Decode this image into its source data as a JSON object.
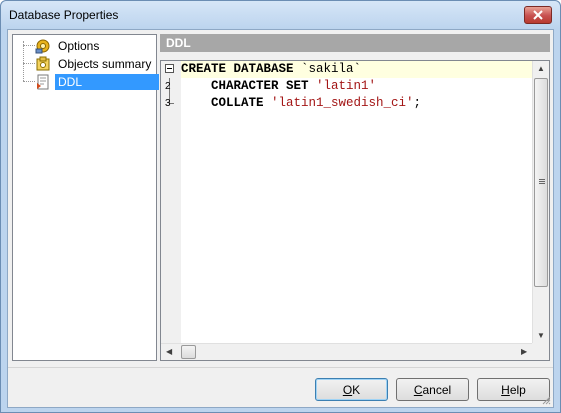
{
  "window": {
    "title": "Database Properties"
  },
  "tree": {
    "items": [
      {
        "label": "Options",
        "icon": "options-icon",
        "selected": false
      },
      {
        "label": "Objects summary",
        "icon": "objects-summary-icon",
        "selected": false
      },
      {
        "label": "DDL",
        "icon": "ddl-icon",
        "selected": true
      }
    ]
  },
  "panel": {
    "header": "DDL"
  },
  "editor": {
    "lines": [
      {
        "number": "",
        "parts": [
          {
            "text": "CREATE DATABASE ",
            "cls": "kw"
          },
          {
            "text": "`sakila`",
            "cls": "ident"
          }
        ]
      },
      {
        "number": "2",
        "parts": [
          {
            "text": "    CHARACTER SET ",
            "cls": "kw"
          },
          {
            "text": "'latin1'",
            "cls": "str"
          }
        ]
      },
      {
        "number": "3",
        "parts": [
          {
            "text": "    COLLATE ",
            "cls": "kw"
          },
          {
            "text": "'latin1_swedish_ci'",
            "cls": "str"
          },
          {
            "text": ";",
            "cls": "ident"
          }
        ]
      }
    ]
  },
  "buttons": {
    "ok": {
      "accel": "O",
      "rest": "K"
    },
    "cancel": {
      "accel": "C",
      "rest": "ancel"
    },
    "help": {
      "accel": "H",
      "rest": "elp"
    }
  },
  "colors": {
    "selection": "#3399ff",
    "panel_header": "#a7a7a7",
    "string": "#a31515",
    "current_line": "#ffffe0"
  }
}
